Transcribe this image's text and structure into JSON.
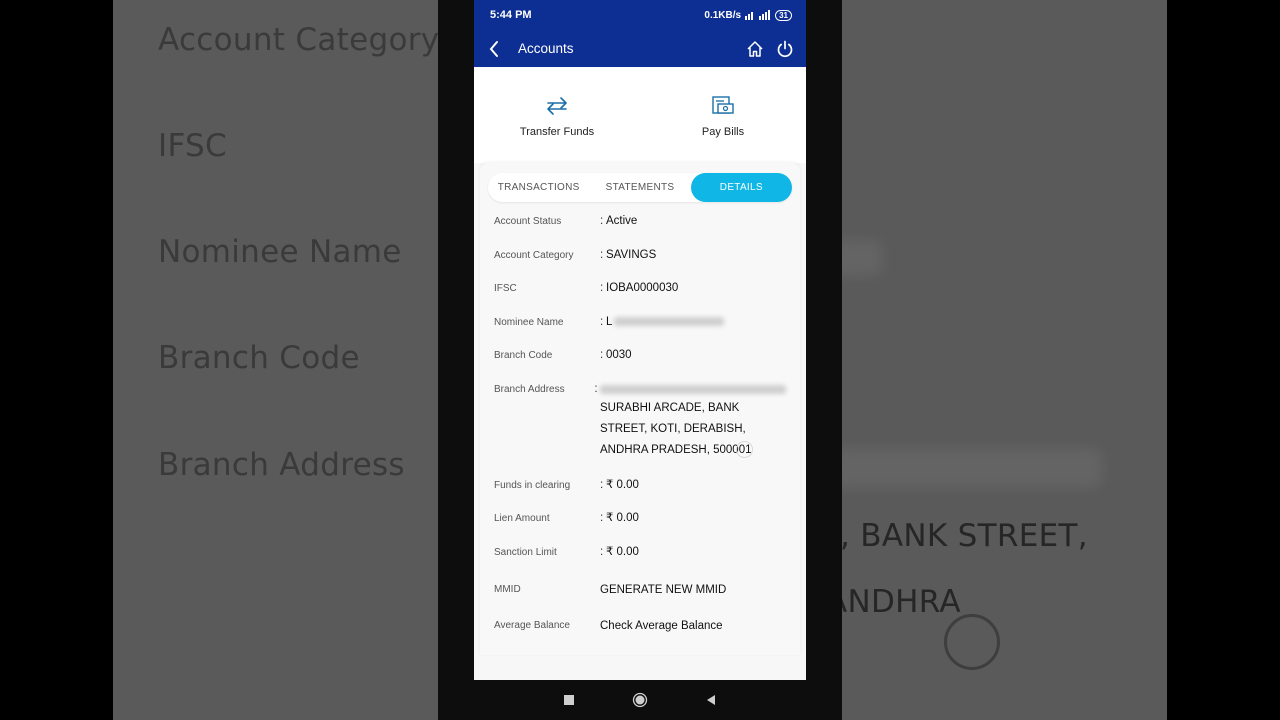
{
  "background": {
    "left_labels": [
      "Account Category",
      "IFSC",
      "Nominee Name",
      "Branch Code",
      "Branch Address"
    ],
    "right_lines": [
      ", BANK STREET,",
      "ANDHRA"
    ]
  },
  "status_bar": {
    "time": "5:44 PM",
    "speed": "0.1KB/s",
    "battery": "31"
  },
  "app_bar": {
    "title": "Accounts"
  },
  "quick_actions": [
    {
      "label": "Transfer Funds",
      "icon": "transfer-icon"
    },
    {
      "label": "Pay Bills",
      "icon": "bill-icon"
    }
  ],
  "tabs": [
    {
      "label": "TRANSACTIONS",
      "active": false
    },
    {
      "label": "STATEMENTS",
      "active": false
    },
    {
      "label": "DETAILS",
      "active": true
    }
  ],
  "details": {
    "account_status": {
      "label": "Account Status",
      "value": "Active"
    },
    "account_category": {
      "label": "Account Category",
      "value": "SAVINGS"
    },
    "ifsc": {
      "label": "IFSC",
      "value": "IOBA0000030"
    },
    "nominee_name": {
      "label": "Nominee Name",
      "value": "L"
    },
    "branch_code": {
      "label": "Branch Code",
      "value": "0030"
    },
    "branch_address": {
      "label": "Branch Address",
      "value": "SURABHI ARCADE, BANK STREET, KOTI, DERABISH, ANDHRA PRADESH, 500001"
    },
    "funds_in_clearing": {
      "label": "Funds in clearing",
      "value": "₹ 0.00"
    },
    "lien_amount": {
      "label": "Lien Amount",
      "value": "₹ 0.00"
    },
    "sanction_limit": {
      "label": "Sanction Limit",
      "value": "₹ 0.00"
    },
    "mmid": {
      "label": "MMID",
      "value": "GENERATE NEW MMID"
    },
    "average_balance": {
      "label": "Average Balance",
      "value": "Check Average Balance"
    }
  },
  "colors": {
    "header": "#0d2f93",
    "accent": "#10b7e6",
    "link": "#1aa3cf"
  }
}
